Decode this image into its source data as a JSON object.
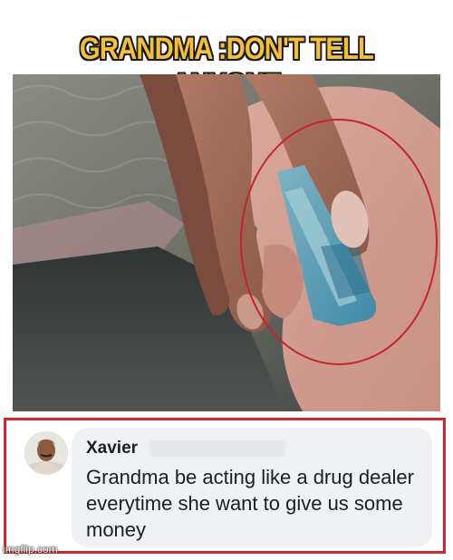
{
  "meme": {
    "caption": "GRANDMA :DON'T TELL ANYONE",
    "caption_color": "#f4c03a"
  },
  "photo": {
    "subject": "hand-holding-folded-banknote",
    "highlight_color": "#c8232b"
  },
  "comment": {
    "author": "Xavier",
    "text": "Grandma be acting like a drug dealer everytime she want to give us some money",
    "frame_color": "#d0262b",
    "bubble_color": "#eff1f4"
  },
  "watermark": "imgflip.com"
}
